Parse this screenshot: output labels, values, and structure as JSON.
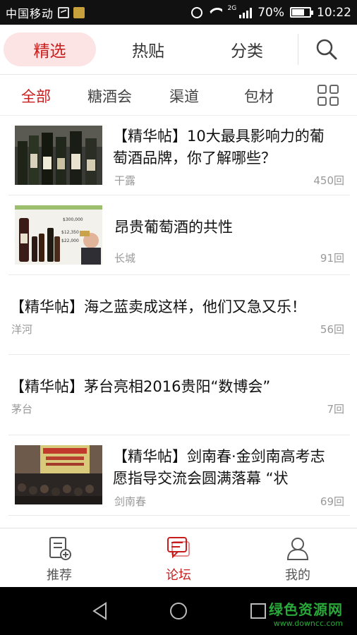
{
  "status_bar": {
    "carrier": "中国移动",
    "network": "2G",
    "battery": "70%",
    "battery_level": 0.7,
    "time": "10:22"
  },
  "top_tabs": [
    {
      "label": "精选",
      "active": true
    },
    {
      "label": "热贴",
      "active": false
    },
    {
      "label": "分类",
      "active": false
    }
  ],
  "search_icon": "search-icon",
  "categories": [
    {
      "label": "全部",
      "active": true
    },
    {
      "label": "糖酒会",
      "active": false
    },
    {
      "label": "渠道",
      "active": false
    },
    {
      "label": "包材",
      "active": false
    }
  ],
  "posts": [
    {
      "title_line1": "【精华帖】10大最具影响力的葡",
      "title_line2": "萄酒品牌，你了解哪些？",
      "author": "干露",
      "count": "450回",
      "has_image": true
    },
    {
      "title_line1": "昂贵葡萄酒的共性",
      "title_line2": "",
      "author": "长城",
      "count": "91回",
      "has_image": true
    },
    {
      "title_line1": "【精华帖】海之蓝卖成这样，他们又急又乐！",
      "title_line2": "",
      "author": "洋河",
      "count": "56回",
      "has_image": false
    },
    {
      "title_line1": "【精华帖】茅台亮相2016贵阳“数博会”",
      "title_line2": "",
      "author": "茅台",
      "count": "7回",
      "has_image": false
    },
    {
      "title_line1": "【精华帖】剑南春·金剑南高考志",
      "title_line2": "愿指导交流会圆满落幕 “状",
      "author": "剑南春",
      "count": "69回",
      "has_image": true
    }
  ],
  "bottom_nav": [
    {
      "label": "推荐",
      "icon": "recommend-icon",
      "active": false
    },
    {
      "label": "论坛",
      "icon": "forum-icon",
      "active": true
    },
    {
      "label": "我的",
      "icon": "profile-icon",
      "active": false
    }
  ],
  "watermark": {
    "brand": "绿色资源网",
    "url": "www.downcc.com"
  },
  "colors": {
    "accent": "#c81d1d",
    "active_tab_bg": "#fde4e4",
    "muted_text": "#999999",
    "watermark": "#29a93a"
  }
}
